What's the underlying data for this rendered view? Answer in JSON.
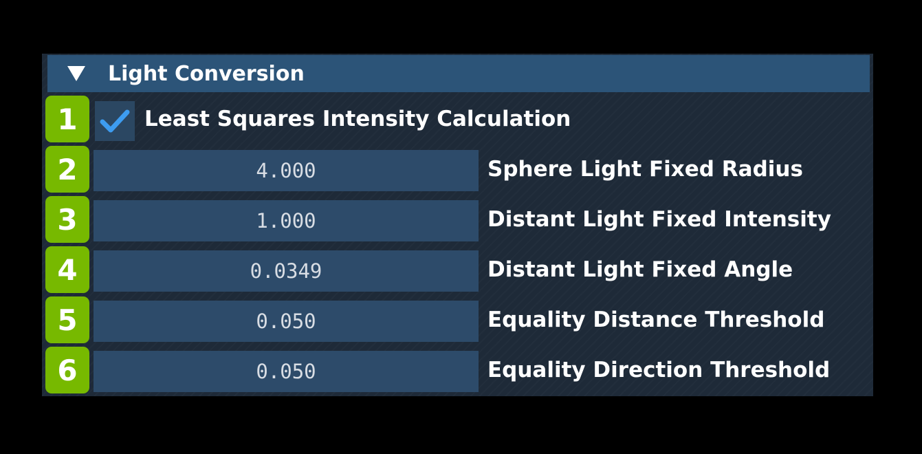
{
  "section": {
    "title": "Light Conversion",
    "accent": "#2c5478"
  },
  "badge_color": "#77b900",
  "rows": [
    {
      "index": "1",
      "type": "checkbox",
      "checked": true,
      "label": "Least Squares Intensity Calculation",
      "icon": "checkmark-icon"
    },
    {
      "index": "2",
      "type": "field",
      "value": "4.000",
      "label": "Sphere Light Fixed Radius"
    },
    {
      "index": "3",
      "type": "field",
      "value": "1.000",
      "label": "Distant Light Fixed Intensity"
    },
    {
      "index": "4",
      "type": "field",
      "value": "0.0349",
      "label": "Distant Light Fixed Angle"
    },
    {
      "index": "5",
      "type": "field",
      "value": "0.050",
      "label": "Equality Distance Threshold"
    },
    {
      "index": "6",
      "type": "field",
      "value": "0.050",
      "label": "Equality Direction Threshold"
    }
  ]
}
